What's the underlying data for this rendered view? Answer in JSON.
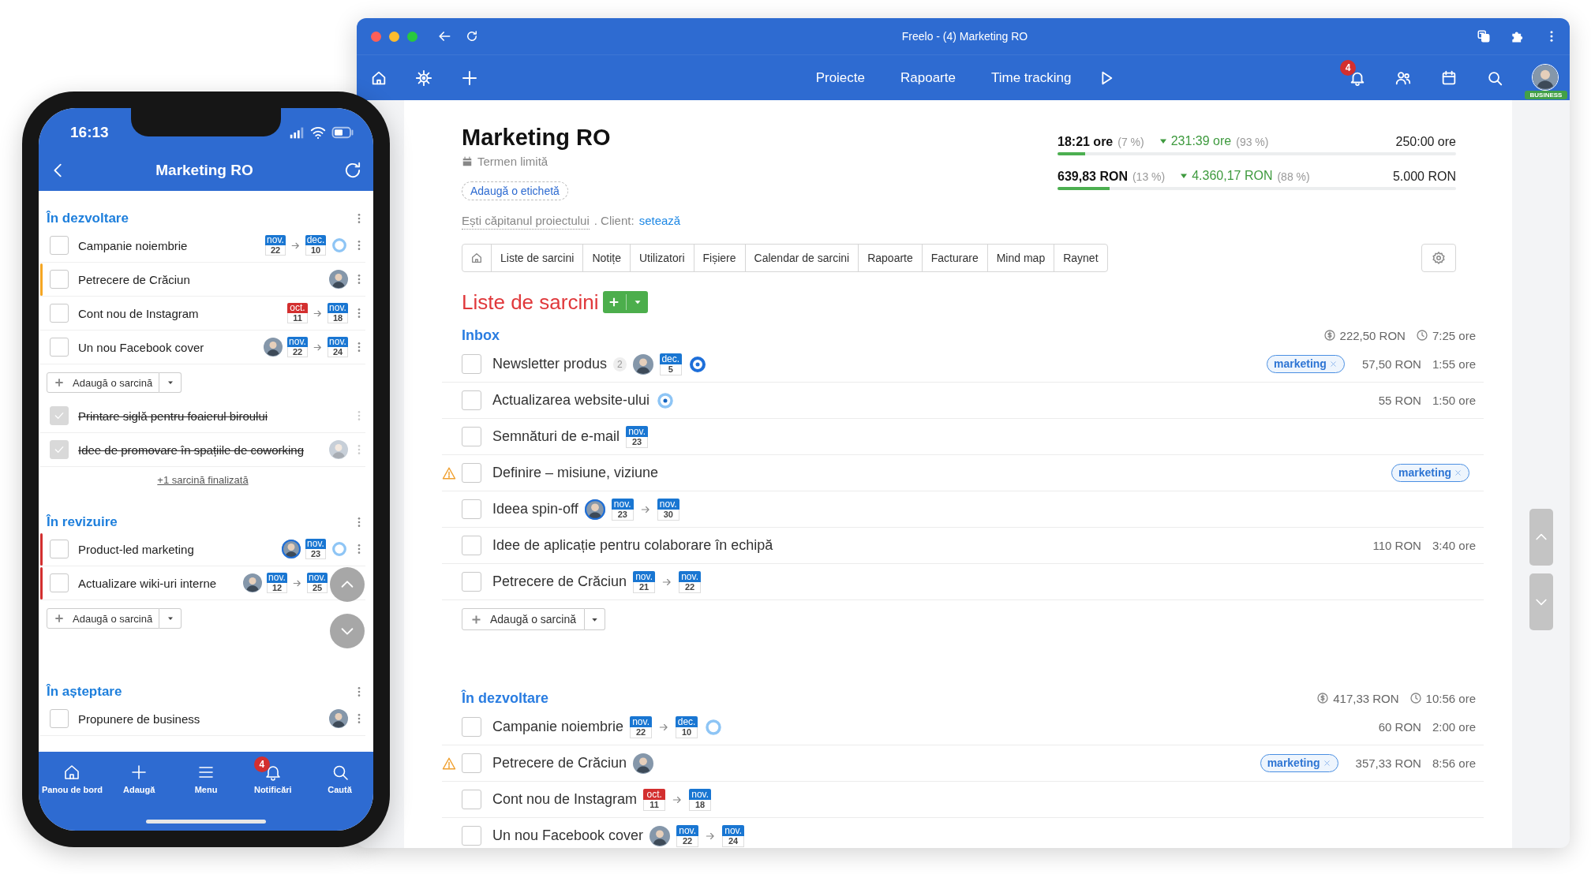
{
  "phone": {
    "status_time": "16:13",
    "title": "Marketing RO",
    "sections": [
      {
        "title": "În dezvoltare",
        "tasks": [
          {
            "name": "Campanie noiembrie",
            "done": false,
            "dates": [
              {
                "month": "nov.",
                "day": "22",
                "color": "#1976d2"
              },
              {
                "month": "dec.",
                "day": "10",
                "color": "#1976d2"
              }
            ],
            "ring": {
              "dot": false,
              "strong": false
            }
          },
          {
            "name": "Petrecere de Crăciun",
            "done": false,
            "color": "#f5a623",
            "avatar": {
              "highlighted": false
            }
          },
          {
            "name": "Cont nou de Instagram",
            "done": false,
            "dates": [
              {
                "month": "oct.",
                "day": "11",
                "color": "#d32f2f"
              },
              {
                "month": "nov.",
                "day": "18",
                "color": "#1976d2"
              }
            ]
          },
          {
            "name": "Un nou Facebook cover",
            "done": false,
            "avatar": {
              "highlighted": false
            },
            "dates": [
              {
                "month": "nov.",
                "day": "22",
                "color": "#1976d2"
              },
              {
                "month": "nov.",
                "day": "24",
                "color": "#1976d2"
              }
            ]
          }
        ],
        "add_label": "Adaugă o sarcină",
        "completed": [
          {
            "name": "Printare siglă pentru foaierul biroului",
            "done": true
          },
          {
            "name": "Idee de promovare în spațiile de coworking",
            "done": true,
            "avatar": {
              "highlighted": false
            }
          }
        ],
        "completed_link": "+1 sarcină finalizată"
      },
      {
        "title": "În revizuire",
        "tasks": [
          {
            "name": "Product-led marketing",
            "done": false,
            "color": "#d32f2f",
            "avatar": {
              "highlighted": true
            },
            "dates": [
              {
                "month": "nov.",
                "day": "23",
                "color": "#1976d2"
              }
            ],
            "ring": {
              "dot": false,
              "strong": false
            }
          },
          {
            "name": "Actualizare wiki-uri interne",
            "done": false,
            "color": "#d32f2f",
            "avatar": {
              "highlighted": false
            },
            "dates": [
              {
                "month": "nov.",
                "day": "12",
                "color": "#1976d2"
              },
              {
                "month": "nov.",
                "day": "25",
                "color": "#1976d2"
              }
            ]
          }
        ],
        "add_label": "Adaugă o sarcină"
      },
      {
        "title": "În așteptare",
        "tasks": [
          {
            "name": "Propunere de business",
            "done": false,
            "avatar": {
              "highlighted": false
            }
          }
        ]
      }
    ],
    "tabbar": [
      {
        "label": "Panou de bord"
      },
      {
        "label": "Adaugă"
      },
      {
        "label": "Menu"
      },
      {
        "label": "Notificări",
        "badge": "4"
      },
      {
        "label": "Caută"
      }
    ]
  },
  "browser": {
    "title": "Freelo - (4) Marketing RO",
    "nav_links": [
      "Proiecte",
      "Rapoarte",
      "Time tracking"
    ],
    "notification_count": "4",
    "account_badge": "BUSINESS"
  },
  "project": {
    "title": "Marketing RO",
    "deadline": "Termen limită",
    "add_label": "Adaugă o etichetă",
    "owner_text": "Ești căpitanul proiectului",
    "client_text": ". Client:",
    "client_link": "setează",
    "stats": [
      {
        "spent": "18:21 ore",
        "spent_pct": "(7 %)",
        "remaining": "231:39 ore",
        "remaining_pct": "(93 %)",
        "total": "250:00 ore",
        "level": 0.07
      },
      {
        "spent": "639,83 RON",
        "spent_pct": "(13 %)",
        "remaining": "4.360,17 RON",
        "remaining_pct": "(88 %)",
        "total": "5.000 RON",
        "level": 0.13
      }
    ],
    "tabs": [
      "Liste de sarcini",
      "Notițe",
      "Utilizatori",
      "Fișiere",
      "Calendar de sarcini",
      "Rapoarte",
      "Facturare",
      "Mind map",
      "Raynet"
    ],
    "heading": "Liste de sarcini",
    "lists": [
      {
        "title": "Inbox",
        "amount": "222,50 RON",
        "time": "7:25 ore",
        "tasks": [
          {
            "name": "Newsletter produs",
            "done": false,
            "warning": false,
            "comments": "2",
            "avatar": {
              "highlighted": false
            },
            "dates": [
              {
                "month": "dec.",
                "day": "5",
                "color": "#1976d2"
              }
            ],
            "ring": {
              "dot": true,
              "strong": true
            },
            "tag": "marketing",
            "amount": "57,50 RON",
            "time": "1:55 ore"
          },
          {
            "name": "Actualizarea website-ului",
            "done": false,
            "warning": false,
            "ring": {
              "dot": true,
              "strong": false
            },
            "amount": "55 RON",
            "time": "1:50 ore"
          },
          {
            "name": "Semnături de e-mail",
            "done": false,
            "warning": false,
            "dates": [
              {
                "month": "nov.",
                "day": "23",
                "color": "#1976d2"
              }
            ]
          },
          {
            "name": "Definire – misiune, viziune",
            "done": false,
            "warning": true,
            "tag": "marketing"
          },
          {
            "name": "Ideea spin-off",
            "done": false,
            "warning": false,
            "avatar": {
              "highlighted": true
            },
            "dates": [
              {
                "month": "nov.",
                "day": "23",
                "color": "#1976d2"
              },
              {
                "month": "nov.",
                "day": "30",
                "color": "#1976d2"
              }
            ]
          },
          {
            "name": "Idee de aplicație pentru colaborare în echipă",
            "done": false,
            "warning": false,
            "amount": "110 RON",
            "time": "3:40 ore"
          },
          {
            "name": "Petrecere de Crăciun",
            "done": false,
            "warning": false,
            "dates": [
              {
                "month": "nov.",
                "day": "21",
                "color": "#1976d2"
              },
              {
                "month": "nov.",
                "day": "22",
                "color": "#1976d2"
              }
            ]
          }
        ],
        "add_label": "Adaugă o sarcină"
      },
      {
        "title": "În dezvoltare",
        "amount": "417,33 RON",
        "time": "10:56 ore",
        "tasks": [
          {
            "name": "Campanie noiembrie",
            "done": false,
            "warning": false,
            "dates": [
              {
                "month": "nov.",
                "day": "22",
                "color": "#1976d2"
              },
              {
                "month": "dec.",
                "day": "10",
                "color": "#1976d2"
              }
            ],
            "ring": {
              "dot": false,
              "strong": false
            },
            "amount": "60 RON",
            "time": "2:00 ore"
          },
          {
            "name": "Petrecere de Crăciun",
            "done": false,
            "warning": true,
            "avatar": {
              "highlighted": false
            },
            "tag": "marketing",
            "amount": "357,33 RON",
            "time": "8:56 ore"
          },
          {
            "name": "Cont nou de Instagram",
            "done": false,
            "warning": false,
            "dates": [
              {
                "month": "oct.",
                "day": "11",
                "color": "#d32f2f"
              },
              {
                "month": "nov.",
                "day": "18",
                "color": "#1976d2"
              }
            ]
          },
          {
            "name": "Un nou Facebook cover",
            "done": false,
            "warning": false,
            "avatar": {
              "highlighted": false
            },
            "dates": [
              {
                "month": "nov.",
                "day": "22",
                "color": "#1976d2"
              },
              {
                "month": "nov.",
                "day": "24",
                "color": "#1976d2"
              }
            ]
          }
        ]
      }
    ]
  }
}
